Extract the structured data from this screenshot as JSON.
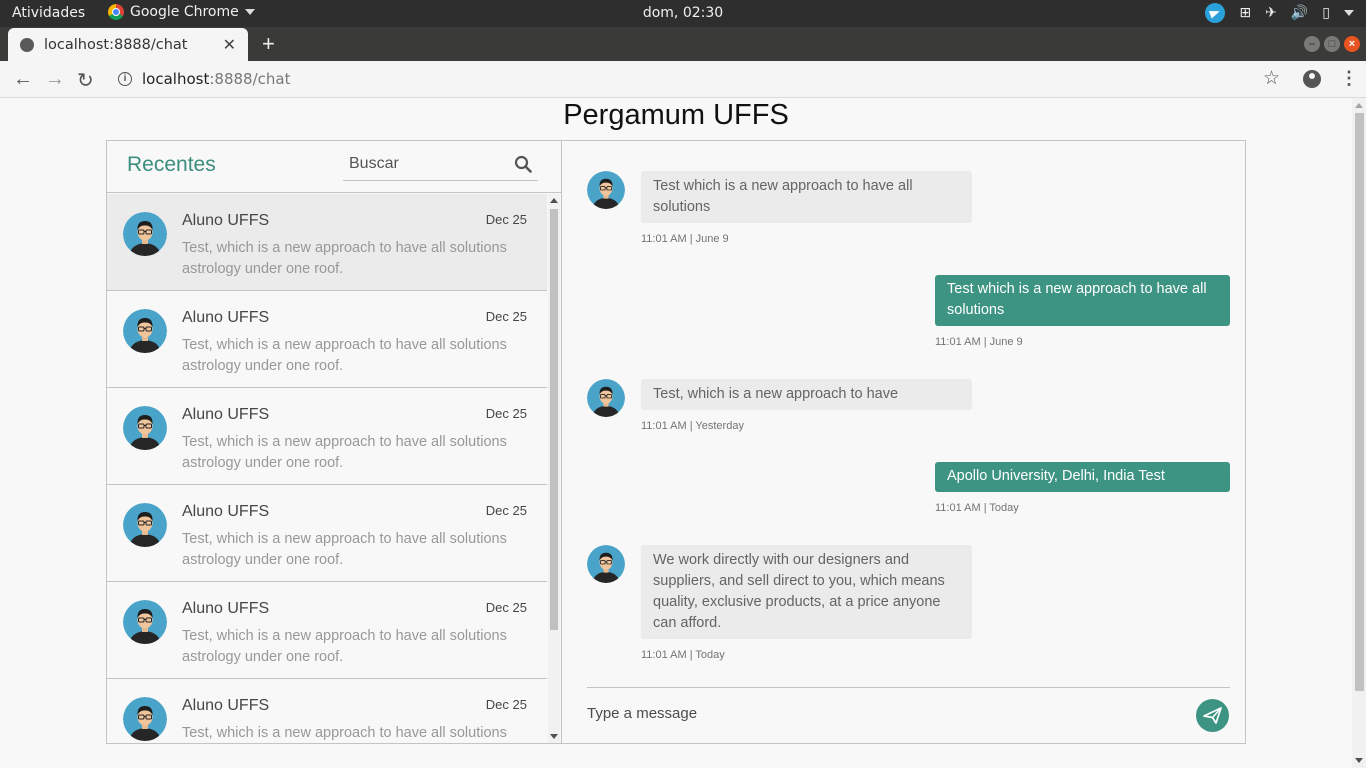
{
  "system": {
    "activities": "Atividades",
    "app_name": "Google Chrome",
    "clock": "dom, 02:30"
  },
  "browser": {
    "tab_title": "localhost:8888/chat",
    "tab_close": "✕",
    "new_tab": "+",
    "url_host": "localhost",
    "url_rest": ":8888/chat"
  },
  "page": {
    "title": "Pergamum UFFS",
    "recent_label": "Recentes",
    "search_placeholder": "Buscar",
    "chats": [
      {
        "name": "Aluno UFFS",
        "date": "Dec 25",
        "preview": "Test, which is a new approach to have all solutions astrology under one roof."
      },
      {
        "name": "Aluno UFFS",
        "date": "Dec 25",
        "preview": "Test, which is a new approach to have all solutions astrology under one roof."
      },
      {
        "name": "Aluno UFFS",
        "date": "Dec 25",
        "preview": "Test, which is a new approach to have all solutions astrology under one roof."
      },
      {
        "name": "Aluno UFFS",
        "date": "Dec 25",
        "preview": "Test, which is a new approach to have all solutions astrology under one roof."
      },
      {
        "name": "Aluno UFFS",
        "date": "Dec 25",
        "preview": "Test, which is a new approach to have all solutions astrology under one roof."
      },
      {
        "name": "Aluno UFFS",
        "date": "Dec 25",
        "preview": "Test, which is a new approach to have all solutions astrology under one roof."
      }
    ],
    "messages": [
      {
        "dir": "in",
        "text": "Test which is a new approach to have all solutions",
        "time": "11:01 AM | June 9"
      },
      {
        "dir": "out",
        "text": "Test which is a new approach to have all solutions",
        "time": "11:01 AM | June 9"
      },
      {
        "dir": "in",
        "text": "Test, which is a new approach to have",
        "time": "11:01 AM | Yesterday"
      },
      {
        "dir": "out",
        "text": "Apollo University, Delhi, India Test",
        "time": "11:01 AM | Today"
      },
      {
        "dir": "in",
        "text": "We work directly with our designers and suppliers, and sell direct to you, which means quality, exclusive products, at a price anyone can afford.",
        "time": "11:01 AM | Today"
      }
    ],
    "message_placeholder": "Type a message"
  },
  "colors": {
    "accent": "#3d9483",
    "avatar_bg": "#4aa3c8",
    "ubuntu_orange": "#e95420"
  }
}
